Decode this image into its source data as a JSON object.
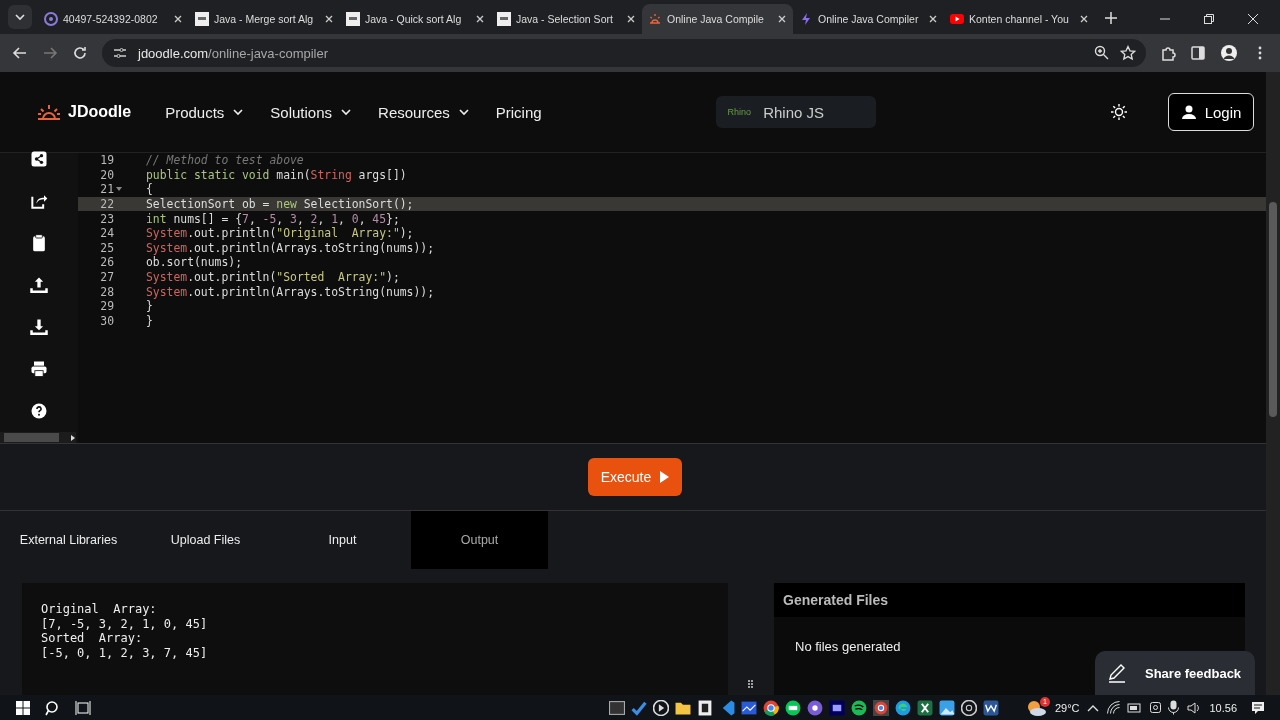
{
  "browser": {
    "tabs": [
      {
        "title": "40497-524392-0802",
        "selected": false,
        "kind": "gear"
      },
      {
        "title": "Java - Merge sort Alg",
        "selected": false,
        "kind": "w3"
      },
      {
        "title": "Java - Quick sort Alg",
        "selected": false,
        "kind": "w3"
      },
      {
        "title": "Java - Selection Sort",
        "selected": false,
        "kind": "w3"
      },
      {
        "title": "Online Java Compile",
        "selected": true,
        "kind": "sun"
      },
      {
        "title": "Online Java Compiler",
        "selected": false,
        "kind": "bolt"
      },
      {
        "title": "Konten channel - You",
        "selected": false,
        "kind": "play"
      }
    ],
    "address": {
      "host": "jdoodle.com",
      "path": "/online-java-compiler"
    }
  },
  "header": {
    "logo": "JDoodle",
    "nav": [
      {
        "label": "Products",
        "dropdown": true
      },
      {
        "label": "Solutions",
        "dropdown": true
      },
      {
        "label": "Resources",
        "dropdown": true
      },
      {
        "label": "Pricing",
        "dropdown": false
      }
    ],
    "engine": {
      "badge": "Rhino",
      "name": "Rhino JS"
    },
    "login": "Login"
  },
  "editor": {
    "lines": [
      {
        "no": "19",
        "fold": false,
        "current": false,
        "tokens": [
          {
            "kind": "comment",
            "t": "// Method to test above"
          }
        ]
      },
      {
        "no": "20",
        "fold": false,
        "current": false,
        "tokens": [
          {
            "kind": "keyword",
            "t": "public static void"
          },
          {
            "kind": "plain",
            "t": " main("
          },
          {
            "kind": "type",
            "t": "String"
          },
          {
            "kind": "plain",
            "t": " args[])"
          }
        ]
      },
      {
        "no": "21",
        "fold": true,
        "current": false,
        "tokens": [
          {
            "kind": "plain",
            "t": "{"
          }
        ]
      },
      {
        "no": "22",
        "fold": false,
        "current": true,
        "tokens": [
          {
            "kind": "plain",
            "t": "SelectionSort ob = "
          },
          {
            "kind": "keyword",
            "t": "new"
          },
          {
            "kind": "plain",
            "t": " SelectionSort();"
          }
        ]
      },
      {
        "no": "23",
        "fold": false,
        "current": false,
        "tokens": [
          {
            "kind": "keyword",
            "t": "int"
          },
          {
            "kind": "plain",
            "t": " nums[] = {"
          },
          {
            "kind": "number",
            "t": "7"
          },
          {
            "kind": "plain",
            "t": ", "
          },
          {
            "kind": "number",
            "t": "-5"
          },
          {
            "kind": "plain",
            "t": ", "
          },
          {
            "kind": "number",
            "t": "3"
          },
          {
            "kind": "plain",
            "t": ", "
          },
          {
            "kind": "number",
            "t": "2"
          },
          {
            "kind": "plain",
            "t": ", "
          },
          {
            "kind": "number",
            "t": "1"
          },
          {
            "kind": "plain",
            "t": ", "
          },
          {
            "kind": "number",
            "t": "0"
          },
          {
            "kind": "plain",
            "t": ", "
          },
          {
            "kind": "number",
            "t": "45"
          },
          {
            "kind": "plain",
            "t": "};"
          }
        ]
      },
      {
        "no": "24",
        "fold": false,
        "current": false,
        "tokens": [
          {
            "kind": "type",
            "t": "System"
          },
          {
            "kind": "plain",
            "t": ".out.println("
          },
          {
            "kind": "string",
            "t": "\"Original  Array:\""
          },
          {
            "kind": "plain",
            "t": ");"
          }
        ]
      },
      {
        "no": "25",
        "fold": false,
        "current": false,
        "tokens": [
          {
            "kind": "type",
            "t": "System"
          },
          {
            "kind": "plain",
            "t": ".out.println(Arrays.toString(nums));"
          }
        ]
      },
      {
        "no": "26",
        "fold": false,
        "current": false,
        "tokens": [
          {
            "kind": "plain",
            "t": "ob.sort(nums);"
          }
        ]
      },
      {
        "no": "27",
        "fold": false,
        "current": false,
        "tokens": [
          {
            "kind": "type",
            "t": "System"
          },
          {
            "kind": "plain",
            "t": ".out.println("
          },
          {
            "kind": "string",
            "t": "\"Sorted  Array:\""
          },
          {
            "kind": "plain",
            "t": ");"
          }
        ]
      },
      {
        "no": "28",
        "fold": false,
        "current": false,
        "tokens": [
          {
            "kind": "type",
            "t": "System"
          },
          {
            "kind": "plain",
            "t": ".out.println(Arrays.toString(nums));"
          }
        ]
      },
      {
        "no": "29",
        "fold": false,
        "current": false,
        "tokens": [
          {
            "kind": "plain",
            "t": "}"
          }
        ]
      },
      {
        "no": "30",
        "fold": false,
        "current": false,
        "tokens": [
          {
            "kind": "plain",
            "t": "}"
          }
        ]
      }
    ]
  },
  "execute": "Execute",
  "io_tabs": [
    {
      "label": "External Libraries",
      "selected": false
    },
    {
      "label": "Upload Files",
      "selected": false
    },
    {
      "label": "Input",
      "selected": false
    },
    {
      "label": "Output",
      "selected": true
    }
  ],
  "output": [
    "Original  Array:",
    "[7, -5, 3, 2, 1, 0, 45]",
    "Sorted  Array:",
    "[-5, 0, 1, 2, 3, 7, 45]"
  ],
  "generated_files": {
    "title": "Generated Files",
    "empty": "No files generated"
  },
  "feedback": "Share feedback",
  "taskbar": {
    "weather_badge": "1",
    "temperature": "29°C",
    "time": "10.56"
  }
}
